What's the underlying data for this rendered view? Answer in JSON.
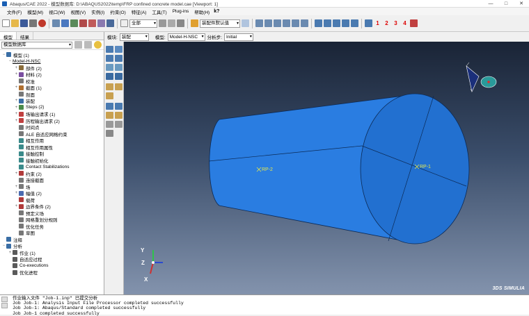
{
  "window": {
    "title": "Abaqus/CAE 2022 - 模型数据库: D:\\ABAQUS2022\\temp\\FRP confined concrete model.cae [Viewport: 1]",
    "minimize": "—",
    "maximize": "□",
    "close": "✕"
  },
  "menu": {
    "items": [
      "文件(F)",
      "模型(M)",
      "视口(W)",
      "视图(V)",
      "实例(I)",
      "约束(O)",
      "特征(A)",
      "工具(T)",
      "Plug-ins",
      "帮助(H)"
    ],
    "help_icon": "k?"
  },
  "toolbar": {
    "selection_filter": "全部",
    "render_style": "装配件默认值",
    "view_numbers": [
      "1",
      "2",
      "3",
      "4"
    ]
  },
  "context_bar": {
    "module_label": "模块:",
    "module_value": "装配",
    "model_label": "模型:",
    "model_value": "Model-H-NSC",
    "step_label": "分析步:",
    "step_value": "Initial"
  },
  "left_panel": {
    "tabs": [
      "模型",
      "结果"
    ],
    "database_select": "模型数据库",
    "tree": [
      {
        "label": "模型 (1)",
        "level": 0,
        "expander": "−",
        "icon": "models-icon",
        "color": "#3a6ea5"
      },
      {
        "label": "Model-H-NSC",
        "level": 1,
        "expander": "−",
        "icon": "",
        "color": ""
      },
      {
        "label": "部件 (2)",
        "level": 2,
        "expander": "+",
        "icon": "parts-icon",
        "color": "#8a6d3b"
      },
      {
        "label": "材料 (2)",
        "level": 2,
        "expander": "+",
        "icon": "materials-icon",
        "color": "#7a4ea0"
      },
      {
        "label": "校准",
        "level": 2,
        "expander": "",
        "icon": "calibration-icon",
        "color": "#777777"
      },
      {
        "label": "截面 (1)",
        "level": 2,
        "expander": "+",
        "icon": "sections-icon",
        "color": "#b07030"
      },
      {
        "label": "剖面",
        "level": 2,
        "expander": "",
        "icon": "profiles-icon",
        "color": "#777777"
      },
      {
        "label": "装配",
        "level": 2,
        "expander": "+",
        "icon": "assembly-icon",
        "color": "#3a6ea5"
      },
      {
        "label": "Steps (2)",
        "level": 2,
        "expander": "+",
        "icon": "steps-icon",
        "color": "#4a8a4a"
      },
      {
        "label": "场输出请求 (1)",
        "level": 2,
        "expander": "+",
        "icon": "field-output-icon",
        "color": "#c04040"
      },
      {
        "label": "历程输出请求 (2)",
        "level": 2,
        "expander": "+",
        "icon": "history-output-icon",
        "color": "#c04040"
      },
      {
        "label": "时间点",
        "level": 2,
        "expander": "",
        "icon": "time-points-icon",
        "color": "#777777"
      },
      {
        "label": "ALE 自适应网格约束",
        "level": 2,
        "expander": "",
        "icon": "ale-icon",
        "color": "#777777"
      },
      {
        "label": "相互作用",
        "level": 2,
        "expander": "",
        "icon": "interactions-icon",
        "color": "#3a8a8a"
      },
      {
        "label": "相互作用属性",
        "level": 2,
        "expander": "",
        "icon": "interaction-props-icon",
        "color": "#3a8a8a"
      },
      {
        "label": "接触控制",
        "level": 2,
        "expander": "",
        "icon": "contact-controls-icon",
        "color": "#3a8a8a"
      },
      {
        "label": "接触初始化",
        "level": 2,
        "expander": "",
        "icon": "contact-init-icon",
        "color": "#3a8a8a"
      },
      {
        "label": "Contact Stabilizations",
        "level": 2,
        "expander": "",
        "icon": "contact-stab-icon",
        "color": "#3a8a8a"
      },
      {
        "label": "约束 (2)",
        "level": 2,
        "expander": "+",
        "icon": "constraints-icon",
        "color": "#b03a3a"
      },
      {
        "label": "连接截面",
        "level": 2,
        "expander": "",
        "icon": "connector-sections-icon",
        "color": "#777777"
      },
      {
        "label": "场",
        "level": 2,
        "expander": "+",
        "icon": "fields-icon",
        "color": "#777777"
      },
      {
        "label": "幅值 (2)",
        "level": 2,
        "expander": "+",
        "icon": "amplitudes-icon",
        "color": "#4a6ab0"
      },
      {
        "label": "载荷",
        "level": 2,
        "expander": "",
        "icon": "loads-icon",
        "color": "#b03a3a"
      },
      {
        "label": "边界条件 (2)",
        "level": 2,
        "expander": "+",
        "icon": "bcs-icon",
        "color": "#b03a3a"
      },
      {
        "label": "预定义场",
        "level": 2,
        "expander": "",
        "icon": "predefined-fields-icon",
        "color": "#777777"
      },
      {
        "label": "网格重划分规则",
        "level": 2,
        "expander": "",
        "icon": "remeshing-icon",
        "color": "#777777"
      },
      {
        "label": "优化任务",
        "level": 2,
        "expander": "",
        "icon": "optimization-icon",
        "color": "#777777"
      },
      {
        "label": "草图",
        "level": 2,
        "expander": "",
        "icon": "sketches-icon",
        "color": "#777777"
      },
      {
        "label": "注释",
        "level": 0,
        "expander": "",
        "icon": "annotations-icon",
        "color": "#3a6ea5"
      },
      {
        "label": "分析",
        "level": 0,
        "expander": "−",
        "icon": "analysis-icon",
        "color": "#3a6ea5"
      },
      {
        "label": "作业 (1)",
        "level": 1,
        "expander": "+",
        "icon": "jobs-icon",
        "color": "#5a5a5a"
      },
      {
        "label": "自适应过程",
        "level": 1,
        "expander": "",
        "icon": "adaptivity-icon",
        "color": "#5a5a5a"
      },
      {
        "label": "Co-executions",
        "level": 1,
        "expander": "",
        "icon": "co-exec-icon",
        "color": "#5a5a5a"
      },
      {
        "label": "优化进程",
        "level": 1,
        "expander": "",
        "icon": "opt-process-icon",
        "color": "#5a5a5a"
      }
    ]
  },
  "viewport": {
    "part_color": "#2a7de1",
    "rp_labels": [
      "RP-2",
      "RP-1"
    ],
    "triad": {
      "y": "Y",
      "z": "Z",
      "x": "X"
    },
    "brand": "3DS SIMULIA"
  },
  "messages": [
    "作业输入文件 \"Job-1.inp\" 已提交分析",
    "Job Job-1: Analysis Input File Processor completed successfully",
    "Job Job-1: Abaqus/Standard completed successfully",
    "Job Job-1 completed successfully"
  ]
}
